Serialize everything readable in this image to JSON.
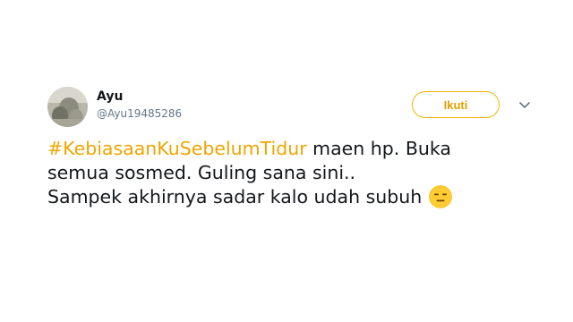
{
  "tweet": {
    "author": {
      "display_name": "Ayu",
      "handle": "@Ayu19485286"
    },
    "follow_button_label": "Ikuti",
    "hashtag": "#KebiasaanKuSebelumTidur",
    "text_line_1_rest": " maen hp. Buka",
    "text_line_2": "semua sosmed. Guling sana sini..",
    "text_line_3": "Sampek akhirnya sadar kalo udah subuh",
    "emoji": "expressionless-face",
    "accent_color": "#f4b400"
  }
}
